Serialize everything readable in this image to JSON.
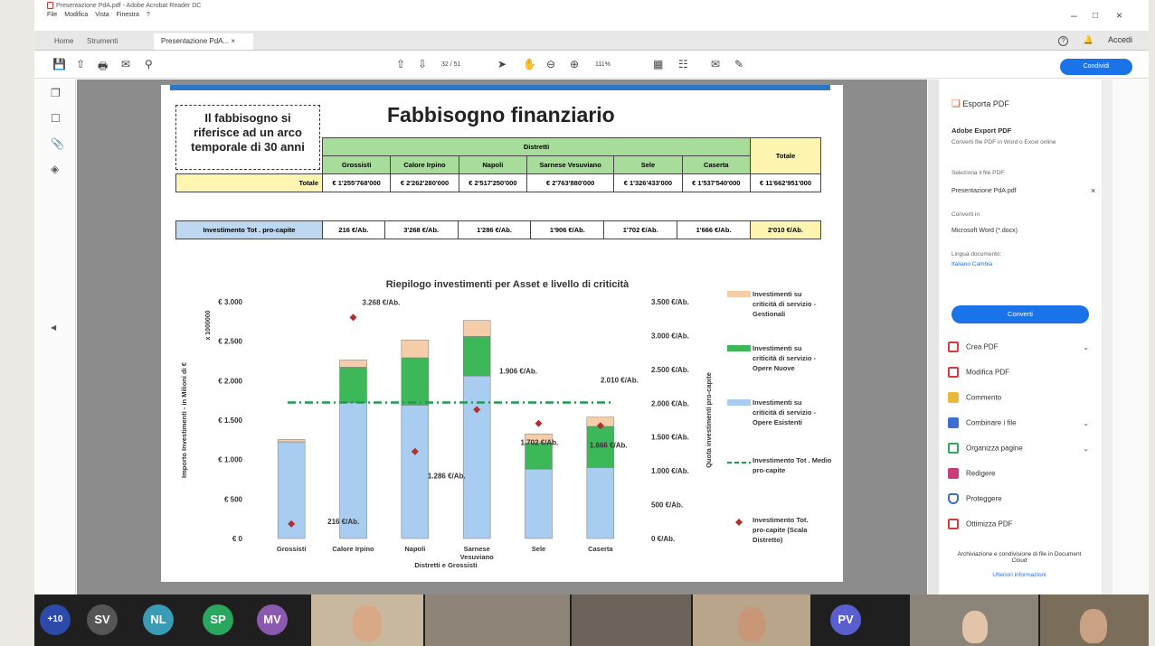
{
  "window": {
    "title": "Presentazione PdA.pdf - Adobe Acrobat Reader DC",
    "menu": [
      "File",
      "Modifica",
      "Vista",
      "Finestra",
      "?"
    ],
    "controls": [
      "–",
      "□",
      "×"
    ]
  },
  "tabs": {
    "home": "Home",
    "tools": "Strumenti",
    "doc": "Presentazione PdA... ×",
    "help": "?",
    "signin": "Accedi"
  },
  "toolbar": {
    "page_indicator": "32 / 51",
    "zoom": "111%",
    "share": "Condividi"
  },
  "slide": {
    "title": "Fabbisogno finanziario",
    "note": [
      "Il fabbisogno si",
      "riferisce ad un arco",
      "temporale di 30 anni"
    ],
    "table": {
      "group_header": "Distretti",
      "columns": [
        "Grossisti",
        "Calore Irpino",
        "Napoli",
        "Sarnese Vesuviano",
        "Sele",
        "Caserta"
      ],
      "total_header": "Totale",
      "total_row_label": "Totale",
      "totals": [
        "€ 1'255'768'000",
        "€ 2'262'280'000",
        "€ 2'517'250'000",
        "€ 2'763'880'000",
        "€ 1'326'433'000",
        "€ 1'537'540'000"
      ],
      "grand_total": "€ 11'662'951'000",
      "percapita_label": "Investimento Tot . pro-capite",
      "percapita": [
        "216 €/Ab.",
        "3'268 €/Ab.",
        "1'286 €/Ab.",
        "1'906 €/Ab.",
        "1'702 €/Ab.",
        "1'666 €/Ab."
      ],
      "percapita_total": "2'010 €/Ab."
    }
  },
  "chart_data": {
    "type": "bar",
    "title": "Riepilogo investimenti per Asset e livello di criticità",
    "xlabel": "Distretti e Grossisti",
    "ylabel": "Importo Investimenti - in Milioni di €",
    "y_multiplier": "x 1000000",
    "y2label": "Quota investimenti pro-capite",
    "categories": [
      "Grossisti",
      "Calore Irpino",
      "Napoli",
      "Sarnese Vesuviano",
      "Sele",
      "Caserta"
    ],
    "ylim": [
      0,
      3000
    ],
    "y_ticks": [
      "€ 0",
      "€ 500",
      "€ 1.000",
      "€ 1.500",
      "€ 2.000",
      "€ 2.500",
      "€ 3.000"
    ],
    "y2lim": [
      0,
      3500
    ],
    "y2_ticks": [
      "0 €/Ab.",
      "500 €/Ab.",
      "1.000 €/Ab.",
      "1.500 €/Ab.",
      "2.000 €/Ab.",
      "2.500 €/Ab.",
      "3.000 €/Ab.",
      "3.500 €/Ab."
    ],
    "series": [
      {
        "name": "Investimenti su criticità di servizio - Opere Esistenti",
        "color": "#a9cdf0",
        "values": [
          1225,
          1720,
          1690,
          2060,
          880,
          900
        ]
      },
      {
        "name": "Investimenti su criticità di servizio - Opere Nuove",
        "color": "#3cb858",
        "values": [
          0,
          450,
          600,
          500,
          330,
          520
        ]
      },
      {
        "name": "Investimenti su criticità di servizio - Gestionali",
        "color": "#f5cda8",
        "values": [
          30,
          92,
          227,
          203,
          116,
          118
        ]
      }
    ],
    "percapita_series": {
      "name": "Investimento Tot. pro-capite (Scala Distretto)",
      "color": "#b03030",
      "values": [
        216,
        3268,
        1286,
        1906,
        1702,
        1666
      ]
    },
    "mean_line": {
      "name": "Investimento Tot . Medio pro-capite",
      "value": 2010,
      "label": "2.010 €/Ab.",
      "color": "#1e9a50"
    },
    "point_labels": [
      "216 €/Ab.",
      "3.268 €/Ab.",
      "1.286 €/Ab.",
      "1.906 €/Ab.",
      "1.702 €/Ab.",
      "1.666 €/Ab."
    ],
    "legend": [
      "Investimenti su criticità di servizio - Gestionali",
      "Investimenti su criticità di servizio - Opere Nuove",
      "Investimenti su criticità di servizio - Opere Esistenti",
      "Investimento Tot . Medio pro-capite",
      "Investimento Tot. pro-capite (Scala Distretto)"
    ],
    "legend_position": "right"
  },
  "panel": {
    "export_title": "Esporta PDF",
    "export_sub": "Adobe Export PDF",
    "export_desc": "Converti file PDF in Word o Excel online",
    "select_label": "Seleziona il file PDF",
    "file": "Presentazione PdA.pdf",
    "convert_to_label": "Converti in",
    "convert_to": "Microsoft Word (*.docx)",
    "lang_label": "Lingua documento:",
    "lang_value": "Italiano Cambia",
    "convert_btn": "Converti",
    "tools": [
      "Crea PDF",
      "Modifica PDF",
      "Commento",
      "Combinare i file",
      "Organizza pagine",
      "Redigere",
      "Proteggere",
      "Ottimizza PDF"
    ],
    "footer1": "Archiviazione e condivisione di file in Document Cloud",
    "footer2": "Ulteriori informazioni"
  },
  "meeting": {
    "participants": [
      "+10",
      "SV",
      "NL",
      "SP",
      "MV",
      "PV"
    ],
    "colors": [
      "#2c4aa8",
      "#555555",
      "#3b9bb5",
      "#2aa65f",
      "#8a5ab0",
      "#5a5fd0"
    ]
  }
}
